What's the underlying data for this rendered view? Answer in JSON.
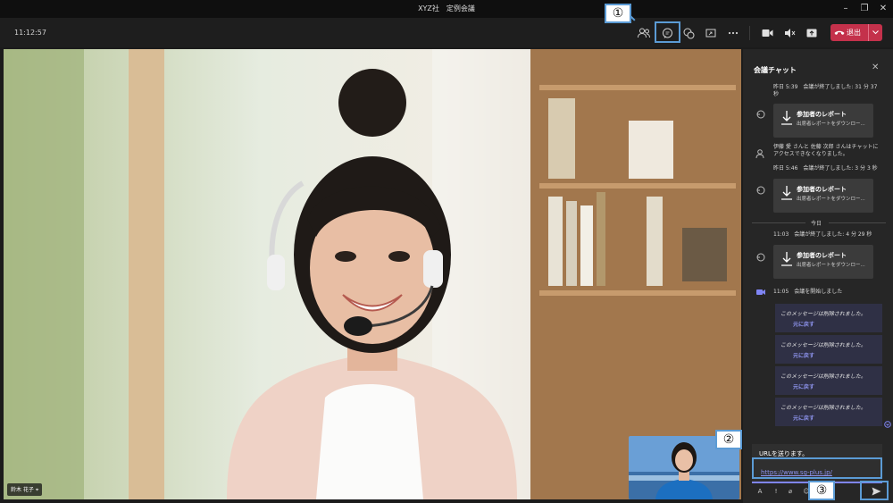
{
  "window": {
    "title": "XYZ社　定例会議",
    "minimize": "–",
    "restore": "❐",
    "close": "✕"
  },
  "toolbar": {
    "clock": "11:12:57",
    "leave_label": "退出",
    "icons": [
      "participants-icon",
      "chat-icon",
      "reactions-icon",
      "share-tray-icon",
      "more-icon",
      "camera-icon",
      "mic-icon",
      "share-icon"
    ]
  },
  "video": {
    "name_tag": "鈴木 花子"
  },
  "chat": {
    "title": "会議チャット",
    "close": "✕",
    "events": [
      {
        "text": "昨日 5:39　会議が終了しました: 31 分 37 秒"
      },
      {
        "text": "伊藤 愛 さんと 佐藤 次郎 さんはチャットにアクセスできなくなりました。"
      },
      {
        "text": "昨日 5:46　会議が終了しました: 3 分 3 秒"
      },
      {
        "text": "11:03　会議が終了しました: 4 分 29 秒"
      },
      {
        "text": "11:05　会議を開始しました"
      }
    ],
    "report_card": {
      "title": "参加者のレポート",
      "subtitle": "出席者レポートをダウンロー..."
    },
    "today_label": "今日",
    "deleted_message": "このメッセージは削除されました。",
    "undo_label": "元に戻す",
    "compose": {
      "text": "URLを送ります。",
      "url": "https://www.sg-plus.jp/"
    }
  },
  "callouts": {
    "one": "①",
    "two": "②",
    "three": "③"
  },
  "colors": {
    "leave": "#c4314b",
    "accent": "#7f85f5",
    "highlight": "#5b9bd5"
  }
}
